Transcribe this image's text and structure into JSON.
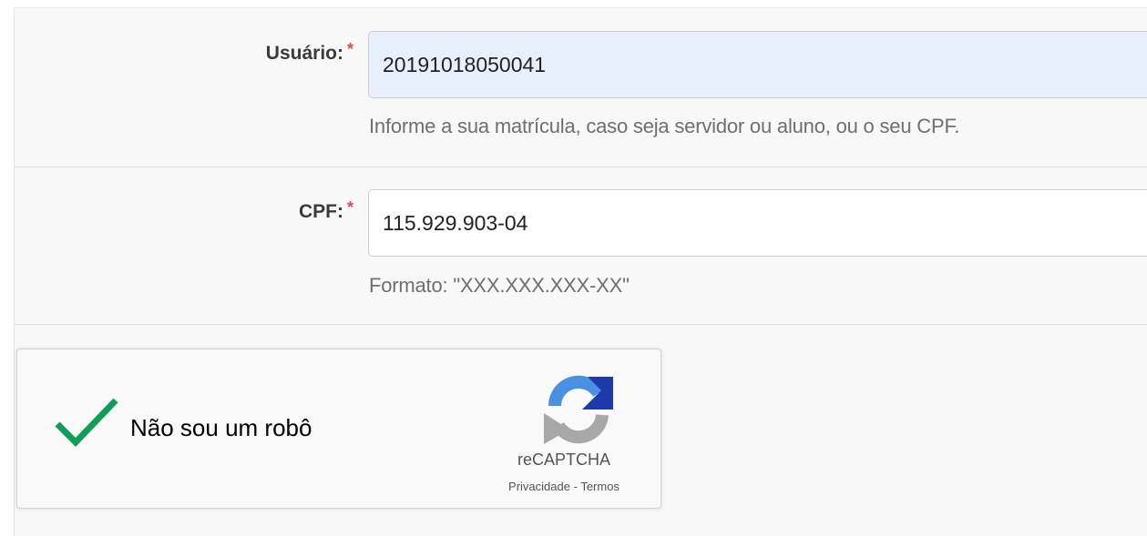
{
  "form": {
    "usuario": {
      "label": "Usuário:",
      "required_mark": "*",
      "value": "20191018050041",
      "help": "Informe a sua matrícula, caso seja servidor ou aluno, ou o seu CPF."
    },
    "cpf": {
      "label": "CPF:",
      "required_mark": "*",
      "value": "115.929.903-04",
      "help": "Formato: \"XXX.XXX.XXX-XX\""
    }
  },
  "recaptcha": {
    "checked": true,
    "label": "Não sou um robô",
    "brand": "reCAPTCHA",
    "privacy": "Privacidade",
    "separator": " - ",
    "terms": "Termos",
    "check_color": "#0f9d58"
  },
  "colors": {
    "autofill_bg": "#e8f0fe",
    "required": "#e04a46",
    "panel_bg": "#f8f8f8"
  }
}
